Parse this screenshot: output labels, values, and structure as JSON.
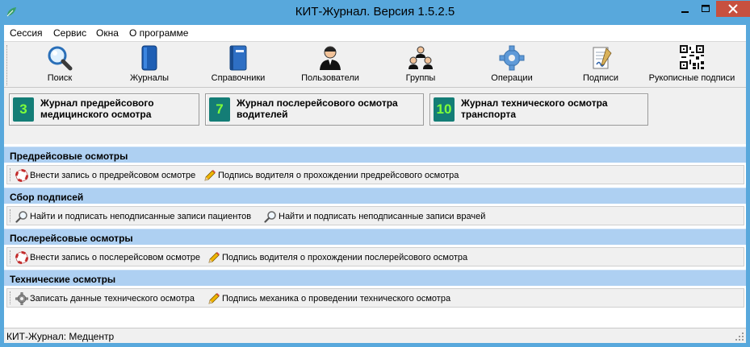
{
  "window": {
    "title": "КИТ-Журнал. Версия 1.5.2.5"
  },
  "menu": [
    "Сессия",
    "Сервис",
    "Окна",
    "О программе"
  ],
  "toolbar": [
    {
      "label": "Поиск",
      "icon": "magnifier-icon"
    },
    {
      "label": "Журналы",
      "icon": "journal-book-icon"
    },
    {
      "label": "Справочники",
      "icon": "reference-book-icon"
    },
    {
      "label": "Пользователи",
      "icon": "user-icon"
    },
    {
      "label": "Группы",
      "icon": "group-icon"
    },
    {
      "label": "Операции",
      "icon": "gear-icon"
    },
    {
      "label": "Подписи",
      "icon": "signature-icon"
    },
    {
      "label": "Рукописные подписи",
      "icon": "qr-code-icon"
    }
  ],
  "journals": [
    {
      "number": "3",
      "label_line1": "Журнал предрейсового",
      "label_line2": "медицинского осмотра"
    },
    {
      "number": "7",
      "label_line1": "Журнал послерейсового осмотра",
      "label_line2": "водителей"
    },
    {
      "number": "10",
      "label_line1": "Журнал технического осмотра",
      "label_line2": "транспорта"
    }
  ],
  "sections": [
    {
      "title": "Предрейсовые осмотры",
      "actions": [
        {
          "label": "Внести запись о предрейсовом осмотре",
          "icon": "lifebuoy-icon"
        },
        {
          "label": "Подпись водителя о прохождении предрейсового осмотра",
          "icon": "pencil-icon"
        }
      ]
    },
    {
      "title": "Сбор подписей",
      "actions": [
        {
          "label": "Найти и подписать неподписанные записи пациентов",
          "icon": "search-icon"
        },
        {
          "label": "Найти и подписать неподписанные записи врачей",
          "icon": "search-icon"
        }
      ]
    },
    {
      "title": "Послерейсовые осмотры",
      "actions": [
        {
          "label": "Внести запись о послерейсовом осмотре",
          "icon": "lifebuoy-icon"
        },
        {
          "label": "Подпись водителя о прохождении послерейсового осмотра",
          "icon": "pencil-icon"
        }
      ]
    },
    {
      "title": "Технические осмотры",
      "actions": [
        {
          "label": "Записать данные технического осмотра",
          "icon": "gear-icon"
        },
        {
          "label": "Подпись механика о проведении технического осмотра",
          "icon": "pencil-icon"
        }
      ]
    }
  ],
  "statusbar": {
    "text": "КИТ-Журнал: Медцентр"
  },
  "colors": {
    "window_frame": "#58a8dc",
    "section_header": "#aed0f2",
    "close_button": "#c7503f",
    "journal_number_bg": "#147d76",
    "journal_number_fg": "#7fff3a"
  }
}
